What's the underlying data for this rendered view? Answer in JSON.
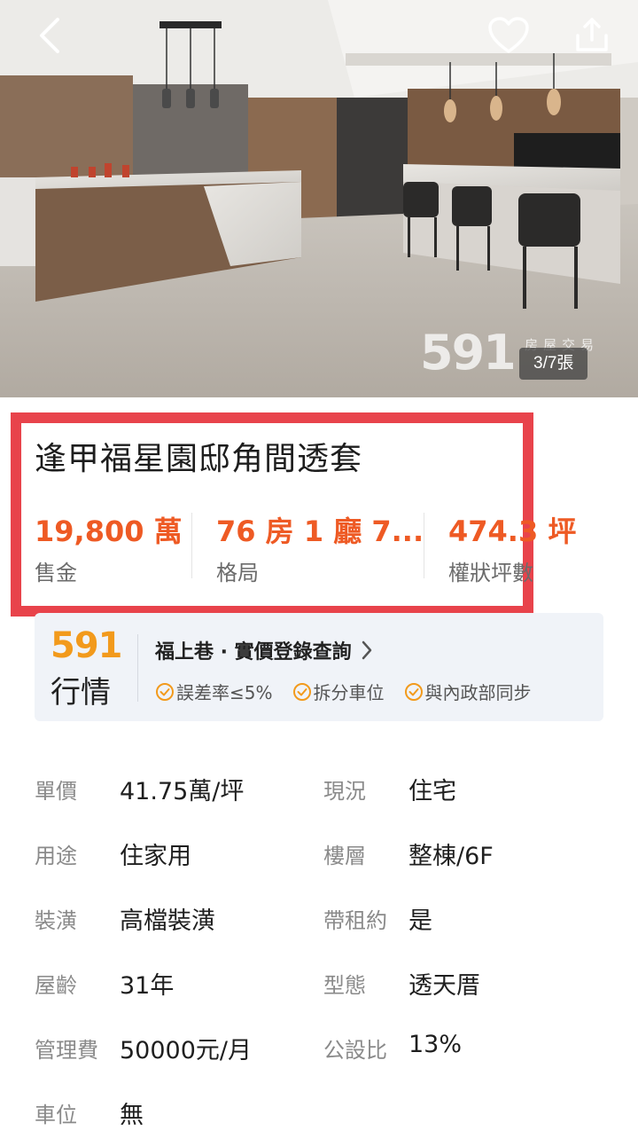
{
  "hero": {
    "counter": "3/7張",
    "watermark_num": "591",
    "watermark_text": "房屋交易"
  },
  "listing": {
    "title": "逢甲福星園邸角間透套",
    "stats": [
      {
        "value": "19,800 萬",
        "label": "售金"
      },
      {
        "value": "76 房 1 廳 7...",
        "label": "格局"
      },
      {
        "value": "474.3 坪",
        "label": "權狀坪數"
      }
    ]
  },
  "market": {
    "logo_num": "591",
    "logo_text": "行情",
    "link_text": "福上巷 · 實價登錄查詢",
    "tags": [
      "誤差率≤5%",
      "拆分車位",
      "與內政部同步"
    ]
  },
  "details": [
    {
      "l1": "單價",
      "v1": "41.75萬/坪",
      "l2": "現況",
      "v2": "住宅"
    },
    {
      "l1": "用途",
      "v1": "住家用",
      "l2": "樓層",
      "v2": "整棟/6F"
    },
    {
      "l1": "裝潢",
      "v1": "高檔裝潢",
      "l2": "帶租約",
      "v2": "是"
    },
    {
      "l1": "屋齡",
      "v1": "31年",
      "l2": "型態",
      "v2": "透天厝"
    },
    {
      "l1": "管理費",
      "v1": "50000元/月",
      "l2": "公設比",
      "v2": "13%"
    },
    {
      "l1": "車位",
      "v1": "無",
      "l2": "",
      "v2": ""
    }
  ],
  "colors": {
    "highlight_border": "#e8434b",
    "price_orange": "#ee5a24",
    "logo_orange": "#f29a1c",
    "card_bg": "#f0f3f8"
  },
  "icons": [
    "back-arrow-icon",
    "heart-icon",
    "share-icon",
    "chevron-right-icon",
    "check-circle-icon"
  ]
}
